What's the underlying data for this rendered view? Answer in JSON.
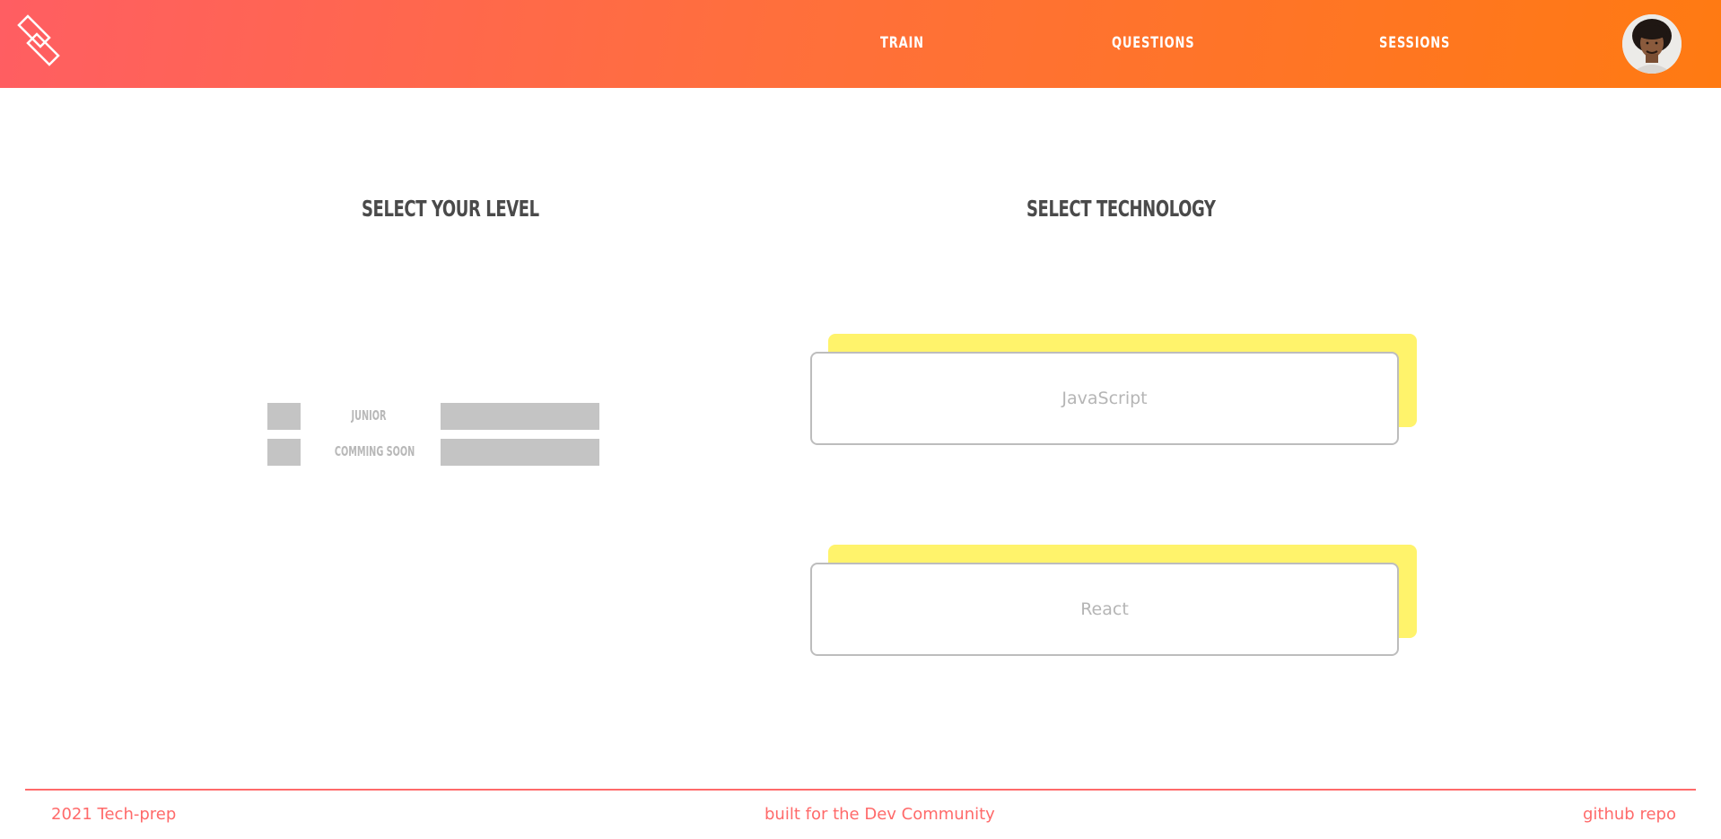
{
  "header": {
    "nav": [
      {
        "label": "TRAIN"
      },
      {
        "label": "QUESTIONS"
      },
      {
        "label": "SESSIONS"
      }
    ]
  },
  "icons": {
    "logo": "diamond-logo-icon",
    "avatar": "user-avatar"
  },
  "level_section": {
    "title": "SELECT YOUR LEVEL",
    "levels": [
      {
        "label": "JUNIOR"
      },
      {
        "label": "COMMING SOON"
      }
    ]
  },
  "tech_section": {
    "title": "SELECT TECHNOLOGY",
    "options": [
      {
        "label": "JavaScript"
      },
      {
        "label": "React"
      }
    ]
  },
  "footer": {
    "left": "2021 Tech-prep",
    "center": "built for the Dev Community",
    "right": "github repo"
  },
  "colors": {
    "header_gradient_start": "#ff5e62",
    "header_gradient_end": "#ff7a12",
    "card_accent": "#fff36b",
    "footer_text": "#ff6a6a"
  }
}
